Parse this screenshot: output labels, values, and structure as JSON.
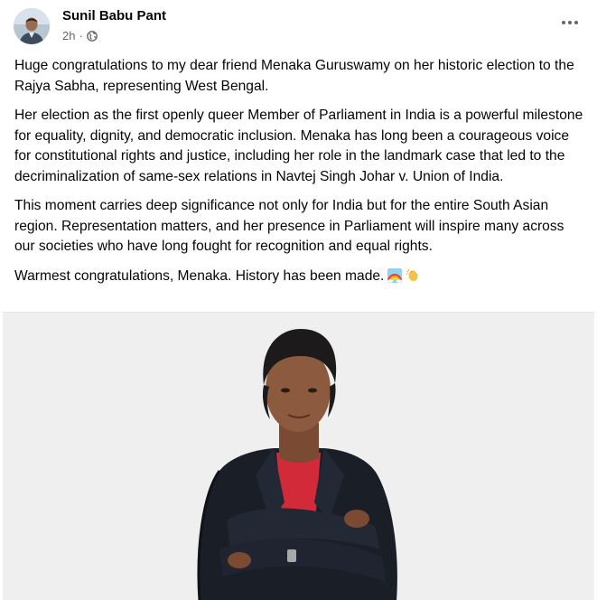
{
  "post": {
    "author": "Sunil Babu Pant",
    "timestamp": "2h",
    "separator": "·",
    "privacy_icon": "globe-icon",
    "more_icon": "more-options-icon",
    "paragraphs": [
      "Huge congratulations to my dear friend Menaka Guruswamy on her historic election to the Rajya Sabha, representing West Bengal.",
      "Her election as the first openly queer Member of Parliament in India is a powerful milestone for equality, dignity, and democratic inclusion. Menaka has long been a courageous voice for constitutional rights and justice, including her role in the landmark case that led to the decriminalization of same-sex relations in Navtej Singh Johar v. Union of India.",
      "This moment carries deep significance not only for India but for the entire South Asian region. Representation matters, and her presence in Parliament will inspire many across our societies who have long fought for recognition and equal rights."
    ],
    "closing": "Warmest congratulations, Menaka. History has been made.",
    "emojis": [
      "rainbow-emoji",
      "clapping-hands-emoji"
    ]
  }
}
